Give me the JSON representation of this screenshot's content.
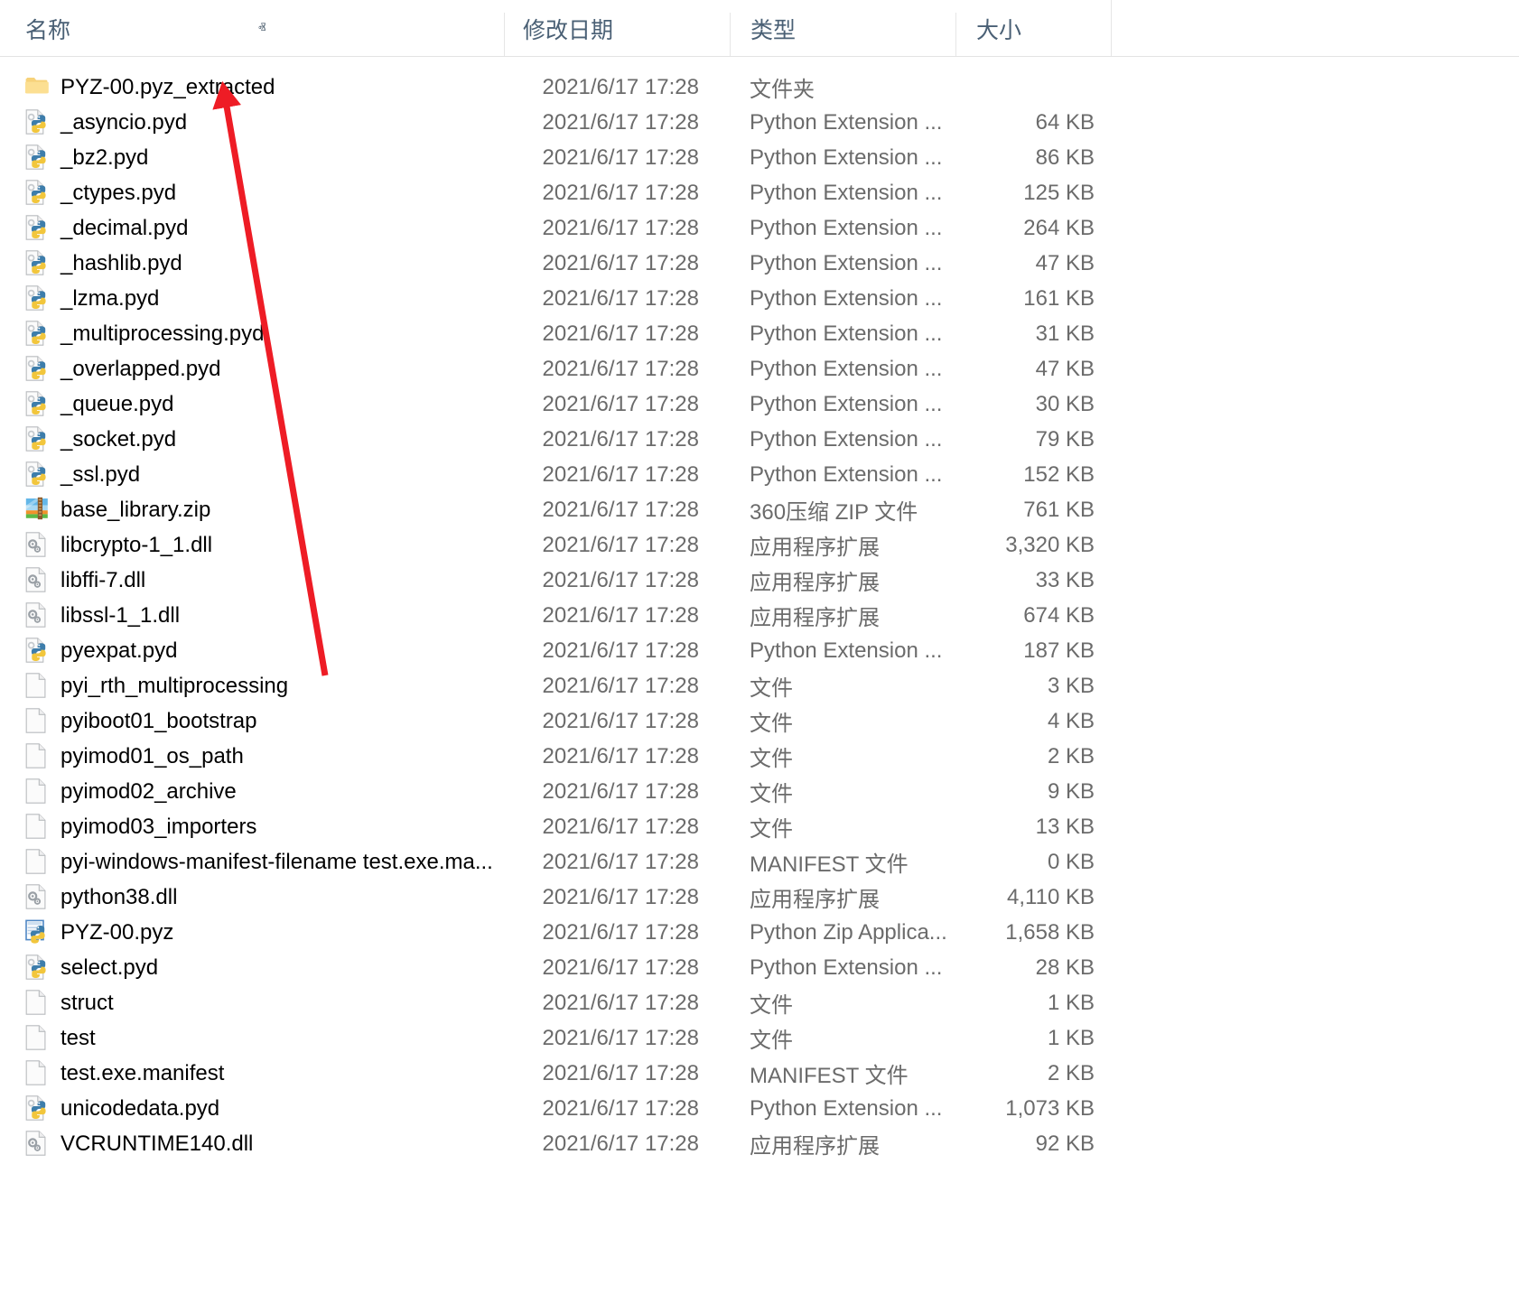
{
  "columns": {
    "name": "名称",
    "date_modified": "修改日期",
    "type": "类型",
    "size": "大小",
    "sort_indicator": "ⱏ"
  },
  "sort": {
    "column": "名称",
    "direction": "ascending"
  },
  "annotation": {
    "type": "arrow",
    "color": "#ee1c25",
    "points_to": "PYZ-00.pyz_extracted"
  },
  "files": [
    {
      "name": "PYZ-00.pyz_extracted",
      "date": "2021/6/17 17:28",
      "type": "文件夹",
      "size": "",
      "icon": "folder-icon"
    },
    {
      "name": "_asyncio.pyd",
      "date": "2021/6/17 17:28",
      "type": "Python Extension ...",
      "size": "64 KB",
      "icon": "python-extension-icon"
    },
    {
      "name": "_bz2.pyd",
      "date": "2021/6/17 17:28",
      "type": "Python Extension ...",
      "size": "86 KB",
      "icon": "python-extension-icon"
    },
    {
      "name": "_ctypes.pyd",
      "date": "2021/6/17 17:28",
      "type": "Python Extension ...",
      "size": "125 KB",
      "icon": "python-extension-icon"
    },
    {
      "name": "_decimal.pyd",
      "date": "2021/6/17 17:28",
      "type": "Python Extension ...",
      "size": "264 KB",
      "icon": "python-extension-icon"
    },
    {
      "name": "_hashlib.pyd",
      "date": "2021/6/17 17:28",
      "type": "Python Extension ...",
      "size": "47 KB",
      "icon": "python-extension-icon"
    },
    {
      "name": "_lzma.pyd",
      "date": "2021/6/17 17:28",
      "type": "Python Extension ...",
      "size": "161 KB",
      "icon": "python-extension-icon"
    },
    {
      "name": "_multiprocessing.pyd",
      "date": "2021/6/17 17:28",
      "type": "Python Extension ...",
      "size": "31 KB",
      "icon": "python-extension-icon"
    },
    {
      "name": "_overlapped.pyd",
      "date": "2021/6/17 17:28",
      "type": "Python Extension ...",
      "size": "47 KB",
      "icon": "python-extension-icon"
    },
    {
      "name": "_queue.pyd",
      "date": "2021/6/17 17:28",
      "type": "Python Extension ...",
      "size": "30 KB",
      "icon": "python-extension-icon"
    },
    {
      "name": "_socket.pyd",
      "date": "2021/6/17 17:28",
      "type": "Python Extension ...",
      "size": "79 KB",
      "icon": "python-extension-icon"
    },
    {
      "name": "_ssl.pyd",
      "date": "2021/6/17 17:28",
      "type": "Python Extension ...",
      "size": "152 KB",
      "icon": "python-extension-icon"
    },
    {
      "name": "base_library.zip",
      "date": "2021/6/17 17:28",
      "type": "360压缩 ZIP 文件",
      "size": "761 KB",
      "icon": "zip-archive-icon"
    },
    {
      "name": "libcrypto-1_1.dll",
      "date": "2021/6/17 17:28",
      "type": "应用程序扩展",
      "size": "3,320 KB",
      "icon": "dll-icon"
    },
    {
      "name": "libffi-7.dll",
      "date": "2021/6/17 17:28",
      "type": "应用程序扩展",
      "size": "33 KB",
      "icon": "dll-icon"
    },
    {
      "name": "libssl-1_1.dll",
      "date": "2021/6/17 17:28",
      "type": "应用程序扩展",
      "size": "674 KB",
      "icon": "dll-icon"
    },
    {
      "name": "pyexpat.pyd",
      "date": "2021/6/17 17:28",
      "type": "Python Extension ...",
      "size": "187 KB",
      "icon": "python-extension-icon"
    },
    {
      "name": "pyi_rth_multiprocessing",
      "date": "2021/6/17 17:28",
      "type": "文件",
      "size": "3 KB",
      "icon": "blank-file-icon"
    },
    {
      "name": "pyiboot01_bootstrap",
      "date": "2021/6/17 17:28",
      "type": "文件",
      "size": "4 KB",
      "icon": "blank-file-icon"
    },
    {
      "name": "pyimod01_os_path",
      "date": "2021/6/17 17:28",
      "type": "文件",
      "size": "2 KB",
      "icon": "blank-file-icon"
    },
    {
      "name": "pyimod02_archive",
      "date": "2021/6/17 17:28",
      "type": "文件",
      "size": "9 KB",
      "icon": "blank-file-icon"
    },
    {
      "name": "pyimod03_importers",
      "date": "2021/6/17 17:28",
      "type": "文件",
      "size": "13 KB",
      "icon": "blank-file-icon"
    },
    {
      "name": "pyi-windows-manifest-filename test.exe.ma...",
      "date": "2021/6/17 17:28",
      "type": "MANIFEST 文件",
      "size": "0 KB",
      "icon": "blank-file-icon"
    },
    {
      "name": "python38.dll",
      "date": "2021/6/17 17:28",
      "type": "应用程序扩展",
      "size": "4,110 KB",
      "icon": "dll-icon"
    },
    {
      "name": "PYZ-00.pyz",
      "date": "2021/6/17 17:28",
      "type": "Python Zip Applica...",
      "size": "1,658 KB",
      "icon": "python-zip-app-icon"
    },
    {
      "name": "select.pyd",
      "date": "2021/6/17 17:28",
      "type": "Python Extension ...",
      "size": "28 KB",
      "icon": "python-extension-icon"
    },
    {
      "name": "struct",
      "date": "2021/6/17 17:28",
      "type": "文件",
      "size": "1 KB",
      "icon": "blank-file-icon"
    },
    {
      "name": "test",
      "date": "2021/6/17 17:28",
      "type": "文件",
      "size": "1 KB",
      "icon": "blank-file-icon"
    },
    {
      "name": "test.exe.manifest",
      "date": "2021/6/17 17:28",
      "type": "MANIFEST 文件",
      "size": "2 KB",
      "icon": "blank-file-icon"
    },
    {
      "name": "unicodedata.pyd",
      "date": "2021/6/17 17:28",
      "type": "Python Extension ...",
      "size": "1,073 KB",
      "icon": "python-extension-icon"
    },
    {
      "name": "VCRUNTIME140.dll",
      "date": "2021/6/17 17:28",
      "type": "应用程序扩展",
      "size": "92 KB",
      "icon": "dll-icon"
    }
  ]
}
